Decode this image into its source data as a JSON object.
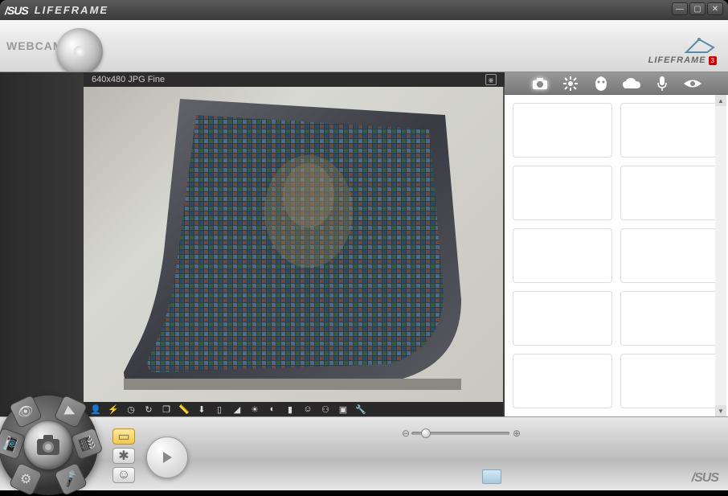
{
  "titlebar": {
    "brand": "/SUS",
    "app_name": "LIFEFRAME"
  },
  "window_controls": {
    "minimize": "—",
    "maximize": "▢",
    "close": "✕"
  },
  "header": {
    "webcam_label": "WEBCAM",
    "logo_text": "LIFEFRAME",
    "logo_badge": "3"
  },
  "preview": {
    "info_text": "640x480 JPG Fine",
    "toolbar_icons": [
      "person-icon",
      "flash-icon",
      "timer-icon",
      "rotate-icon",
      "stack-icon",
      "ruler-icon",
      "arrow-down-icon",
      "phone-icon",
      "contrast-icon",
      "sun-icon",
      "half-icon",
      "bars-icon",
      "face-icon",
      "blur-icon",
      "frame-icon",
      "wrench-icon"
    ]
  },
  "right_tabs": [
    "camera-icon",
    "flower-icon",
    "mask-icon",
    "cloud-icon",
    "mic-icon",
    "eye-icon"
  ],
  "right_tabs_active_index": 0,
  "thumbnail_count": 10,
  "mode_wheel": {
    "segments": [
      "eye-mode-icon",
      "play-mode-icon",
      "camera-mode-icon",
      "video-mode-icon",
      "gear-mode-icon",
      "mic-mode-icon"
    ],
    "center": "shutter-icon"
  },
  "side_buttons": [
    {
      "name": "gallery-button",
      "active": true,
      "glyph": "▭"
    },
    {
      "name": "effects-button",
      "active": false,
      "glyph": "✱"
    },
    {
      "name": "face-button",
      "active": false,
      "glyph": "☺"
    }
  ],
  "play_button": "play-icon",
  "zoom": {
    "minus": "⊖",
    "plus": "⊕"
  },
  "footer_brand": "/SUS",
  "colors": {
    "titlebar_bg": "#4a4a4a",
    "header_bg": "#e8e8e8",
    "panel_bg": "#ffffff",
    "dark_bg": "#383838",
    "active_tab": "#f0c850"
  }
}
